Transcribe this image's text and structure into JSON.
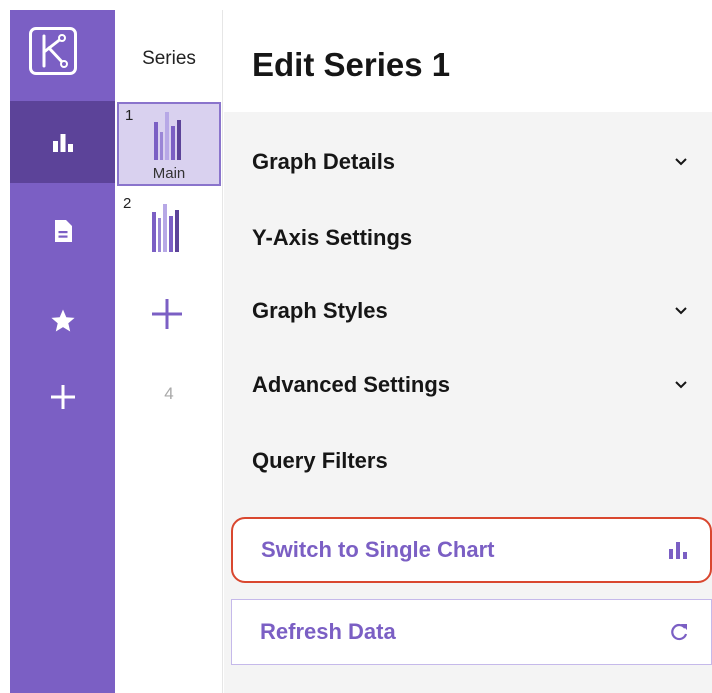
{
  "nav": {
    "logo_icon": "k-logo-icon",
    "items": [
      {
        "icon": "bar-chart-icon",
        "active": true
      },
      {
        "icon": "document-icon",
        "active": false
      },
      {
        "icon": "star-icon",
        "active": false
      },
      {
        "icon": "plus-icon",
        "active": false
      }
    ],
    "colors": {
      "rail": "#7b5fc4",
      "active": "#5c4399"
    }
  },
  "series_panel": {
    "title": "Series",
    "thumbnails": [
      {
        "number": "1",
        "caption": "Main",
        "selected": true
      },
      {
        "number": "2",
        "caption": "",
        "selected": false
      }
    ],
    "add_icon": "plus-icon",
    "next_slot": "4"
  },
  "editor": {
    "title": "Edit Series 1",
    "sections": [
      {
        "label": "Graph Details",
        "expandable": true
      },
      {
        "label": "Y-Axis Settings",
        "expandable": false
      },
      {
        "label": "Graph Styles",
        "expandable": true
      },
      {
        "label": "Advanced Settings",
        "expandable": true
      },
      {
        "label": "Query Filters",
        "expandable": false
      }
    ],
    "actions": [
      {
        "label": "Switch to Single Chart",
        "icon": "bar-chart-icon",
        "highlighted": true
      },
      {
        "label": "Refresh Data",
        "icon": "refresh-icon",
        "highlighted": false
      }
    ],
    "colors": {
      "accent": "#7b5fc4",
      "highlight": "#d9472f"
    }
  }
}
